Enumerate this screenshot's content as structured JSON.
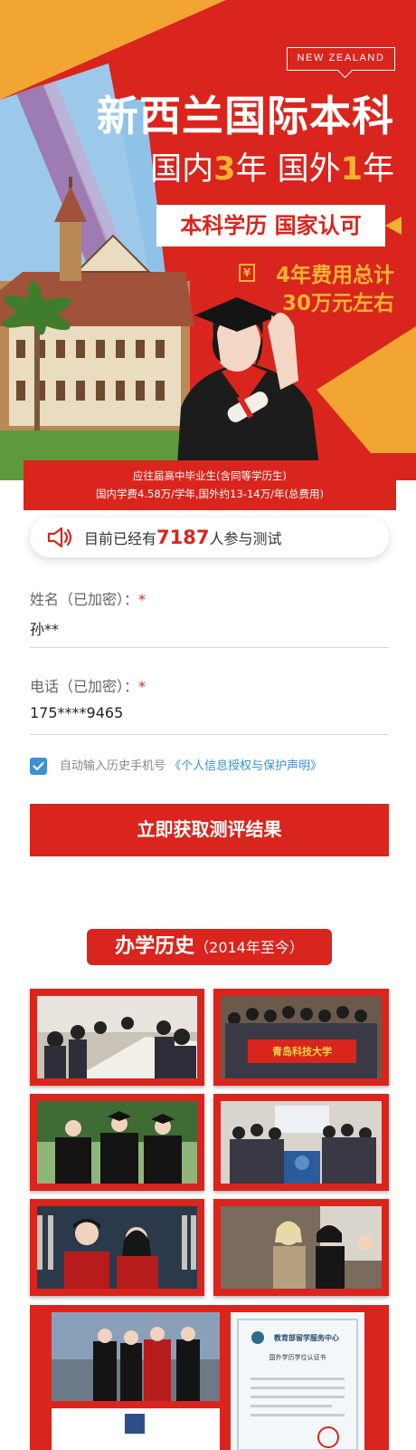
{
  "hero": {
    "badge": "NEW ZEALAND",
    "title": "新西兰国际本科",
    "sub_part1": "国内",
    "sub_num1": "3",
    "sub_part2": "年  国外",
    "sub_num2": "1",
    "sub_part3": "年",
    "certification": "本科学历 国家认可",
    "fee_line1": "4年费用总计",
    "fee_line2": "30万元左右",
    "fee_icon": "yen-icon",
    "eligibility": "应往届高中毕业生(含同等学历生)",
    "tuition": "国内学费4.58万/学年,国外约13-14万/年(总费用)"
  },
  "participants": {
    "prefix": "目前已经有",
    "count": "7187",
    "suffix": "人参与测试",
    "icon": "speaker-icon"
  },
  "form": {
    "name_label": "姓名（已加密）：",
    "name_value": "孙**",
    "phone_label": "电话（已加密）：",
    "phone_value": "175****9465",
    "required_mark": "*",
    "autofill_text": "自动输入历史手机号",
    "policy_link": "《个人信息授权与保护声明》",
    "autofill_checked": true,
    "submit_label": "立即获取测评结果"
  },
  "history": {
    "title": "办学历史",
    "period": "（2014年至今）",
    "banner_text": "青岛科技大学",
    "certificate_header": "教育部留学服务中心",
    "certificate_title": "国外学历学位认证书"
  },
  "colors": {
    "brand_red": "#d9251d",
    "accent_gold": "#f2b233",
    "link_blue": "#3d8fd6"
  }
}
